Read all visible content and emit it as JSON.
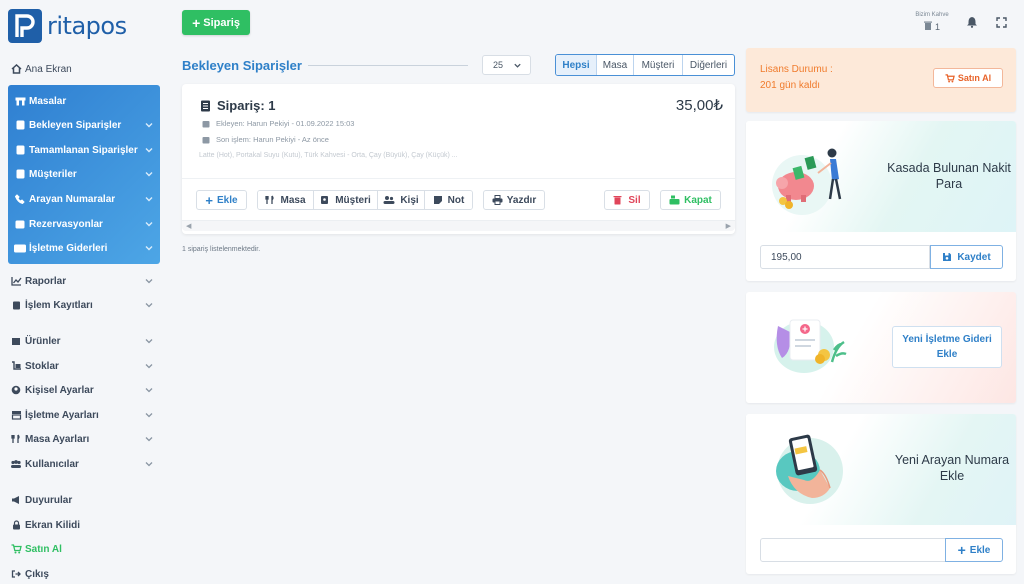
{
  "brand": {
    "name": "ritapos"
  },
  "sidebar": {
    "items": [
      {
        "label": "Ana Ekran",
        "icon": "home-icon",
        "chevron": false
      },
      {
        "label": "Masalar",
        "icon": "table-icon",
        "chevron": false
      },
      {
        "label": "Bekleyen Siparişler",
        "icon": "receipt-icon",
        "chevron": true
      },
      {
        "label": "Tamamlanan Siparişler",
        "icon": "receipt-icon",
        "chevron": true
      },
      {
        "label": "Müşteriler",
        "icon": "address-book-icon",
        "chevron": true
      },
      {
        "label": "Arayan Numaralar",
        "icon": "phone-icon",
        "chevron": true
      },
      {
        "label": "Rezervasyonlar",
        "icon": "calendar-icon",
        "chevron": true
      },
      {
        "label": "İşletme Giderleri",
        "icon": "money-icon",
        "chevron": true
      },
      {
        "label": "Raporlar",
        "icon": "chart-icon",
        "chevron": true
      },
      {
        "label": "İşlem Kayıtları",
        "icon": "clipboard-icon",
        "chevron": true
      },
      {
        "label": "Ürünler",
        "icon": "box-icon",
        "chevron": true
      },
      {
        "label": "Stoklar",
        "icon": "dolly-icon",
        "chevron": true
      },
      {
        "label": "Kişisel Ayarlar",
        "icon": "user-circle-icon",
        "chevron": true
      },
      {
        "label": "İşletme Ayarları",
        "icon": "store-icon",
        "chevron": true
      },
      {
        "label": "Masa Ayarları",
        "icon": "utensils-icon",
        "chevron": true
      },
      {
        "label": "Kullanıcılar",
        "icon": "users-icon",
        "chevron": true
      },
      {
        "label": "Duyurular",
        "icon": "megaphone-icon",
        "chevron": false
      },
      {
        "label": "Ekran Kilidi",
        "icon": "lock-icon",
        "chevron": false
      },
      {
        "label": "Satın Al",
        "icon": "cart-icon",
        "chevron": false
      },
      {
        "label": "Çıkış",
        "icon": "logout-icon",
        "chevron": false
      }
    ]
  },
  "topbar": {
    "new_order_label": "Sipariş",
    "business_name": "Bizim Kahve",
    "business_count": "1"
  },
  "main": {
    "title": "Bekleyen Siparişler",
    "page_size": "25",
    "filters": [
      "Hepsi",
      "Masa",
      "Müşteri",
      "Diğerleri"
    ],
    "active_filter": "Hepsi",
    "order": {
      "title": "Sipariş: 1",
      "total": "35,00₺",
      "added": "Ekleyen: Harun Pekiyi - 01.09.2022 15:03",
      "last_action": "Son işlem: Harun Pekiyi - Az önce",
      "items": "Latte (Hot), Portakal Suyu (Kutu), Türk Kahvesi - Orta, Çay (Büyük), Çay (Küçük) ...",
      "buttons": {
        "add": "Ekle",
        "table": "Masa",
        "customer": "Müşteri",
        "person": "Kişi",
        "note": "Not",
        "print": "Yazdır",
        "delete": "Sil",
        "close": "Kapat"
      }
    },
    "count_text": "1 sipariş listelenmektedir."
  },
  "widgets": {
    "license": {
      "line1": "Lisans Durumu :",
      "line2": "201 gün kaldı",
      "buy": "Satın Al"
    },
    "cash": {
      "title": "Kasada Bulunan Nakit Para",
      "value": "195,00",
      "save": "Kaydet"
    },
    "expense": {
      "button": "Yeni İşletme Gideri Ekle"
    },
    "caller": {
      "title": "Yeni Arayan Numara Ekle",
      "value": "",
      "add": "Ekle"
    }
  },
  "colors": {
    "primary": "#2f80c8",
    "success": "#2fbf63",
    "danger": "#e0455a",
    "warning": "#f07b2c"
  }
}
